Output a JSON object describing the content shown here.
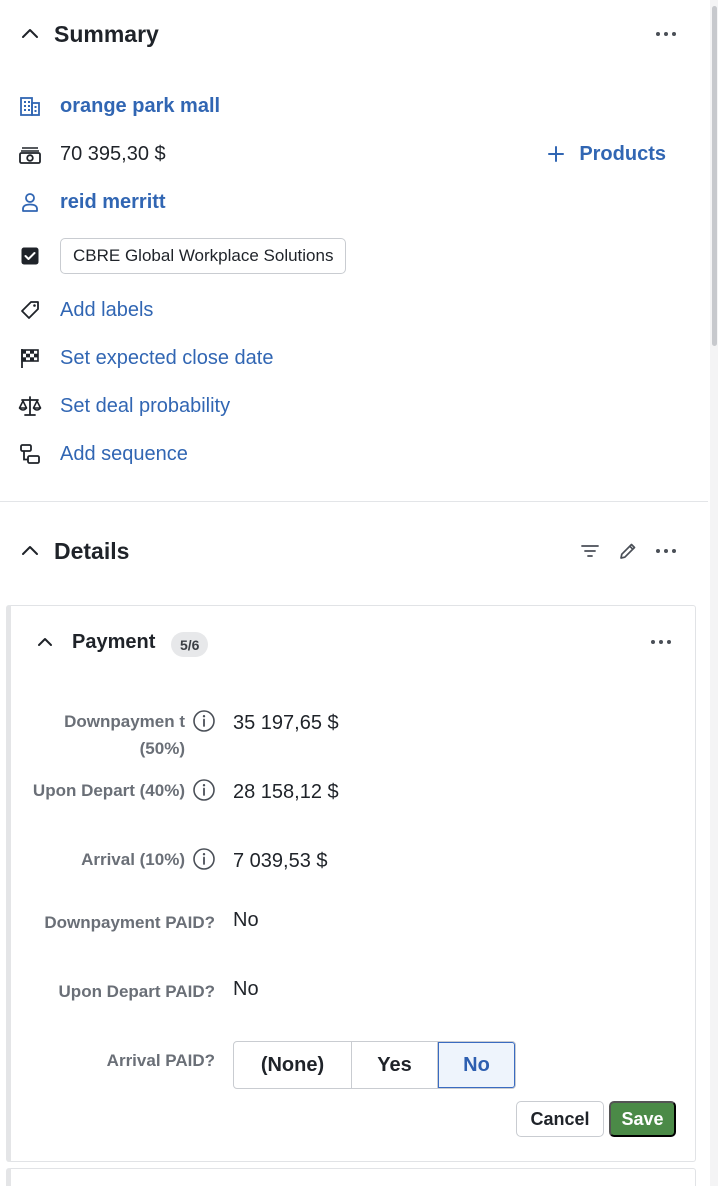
{
  "summary": {
    "title": "Summary",
    "org_name": "orange park mall",
    "value": "70 395,30 $",
    "products_label": "Products",
    "person": "reid merritt",
    "org_chip": "CBRE Global Workplace Solutions",
    "add_labels": "Add labels",
    "close_date": "Set expected close date",
    "probability": "Set deal probability",
    "sequence": "Add sequence"
  },
  "details": {
    "title": "Details"
  },
  "payment": {
    "title": "Payment",
    "badge": "5/6",
    "fields": [
      {
        "label": "Downpaymen t (50%)",
        "value": "35 197,65 $"
      },
      {
        "label": "Upon Depart (40%)",
        "value": "28 158,12 $"
      },
      {
        "label": "Arrival (10%)",
        "value": "7 039,53 $"
      },
      {
        "label": "Downpayment PAID?",
        "value": "No"
      },
      {
        "label": "Upon Depart PAID?",
        "value": "No"
      },
      {
        "label": "Arrival PAID?",
        "value": ""
      }
    ],
    "options": [
      "(None)",
      "Yes",
      "No"
    ],
    "selected": "No",
    "cancel_label": "Cancel",
    "save_label": "Save"
  },
  "colors": {
    "link": "#3166b3",
    "save": "#4b8a47",
    "selected_border": "#3a6bc1"
  }
}
